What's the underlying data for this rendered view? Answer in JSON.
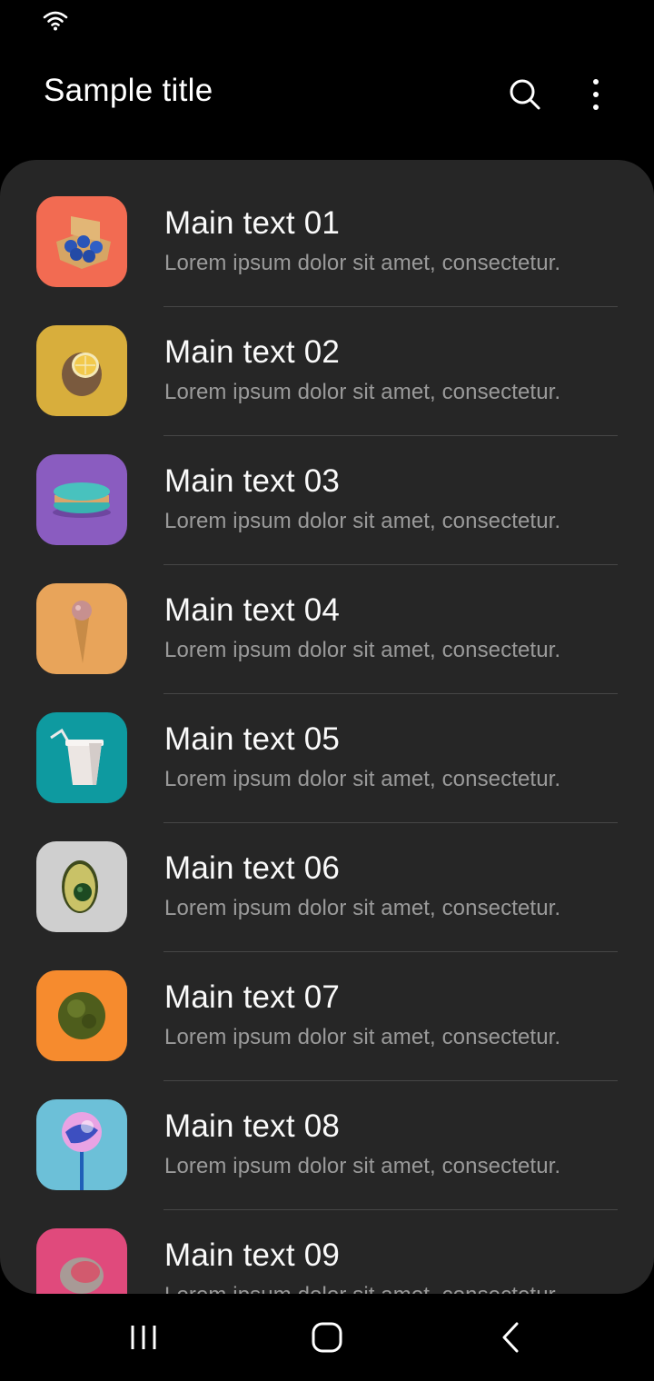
{
  "status_bar": {
    "icons": [
      "wifi-icon"
    ]
  },
  "app_bar": {
    "title": "Sample title",
    "actions": [
      "search-icon",
      "more-vertical-icon"
    ]
  },
  "list": {
    "items": [
      {
        "main": "Main text 01",
        "sub": "Lorem ipsum dolor sit amet, consectetur.",
        "thumb_color": "#f26b52",
        "thumb_subject": "blue eggs in carton"
      },
      {
        "main": "Main text 02",
        "sub": "Lorem ipsum dolor sit amet, consectetur.",
        "thumb_color": "#d8ae3c",
        "thumb_subject": "lemon"
      },
      {
        "main": "Main text 03",
        "sub": "Lorem ipsum dolor sit amet, consectetur.",
        "thumb_color": "#8a5cc0",
        "thumb_subject": "macaron"
      },
      {
        "main": "Main text 04",
        "sub": "Lorem ipsum dolor sit amet, consectetur.",
        "thumb_color": "#e8a45a",
        "thumb_subject": "ice cream cone"
      },
      {
        "main": "Main text 05",
        "sub": "Lorem ipsum dolor sit amet, consectetur.",
        "thumb_color": "#0e9aa0",
        "thumb_subject": "paper cup with straw"
      },
      {
        "main": "Main text 06",
        "sub": "Lorem ipsum dolor sit amet, consectetur.",
        "thumb_color": "#cfcfcf",
        "thumb_subject": "avocado"
      },
      {
        "main": "Main text 07",
        "sub": "Lorem ipsum dolor sit amet, consectetur.",
        "thumb_color": "#f68b2e",
        "thumb_subject": "moss ball"
      },
      {
        "main": "Main text 08",
        "sub": "Lorem ipsum dolor sit amet, consectetur.",
        "thumb_color": "#6cc0d8",
        "thumb_subject": "lollipop"
      },
      {
        "main": "Main text 09",
        "sub": "Lorem ipsum dolor sit amet, consectetur.",
        "thumb_color": "#e04a7c",
        "thumb_subject": "stone"
      }
    ]
  },
  "nav_bar": {
    "buttons": [
      "recents-icon",
      "home-icon",
      "back-icon"
    ]
  },
  "colors": {
    "background": "#000000",
    "card": "#262626",
    "main_text": "#fafafa",
    "sub_text": "#9a9a9a",
    "divider": "#464646"
  }
}
